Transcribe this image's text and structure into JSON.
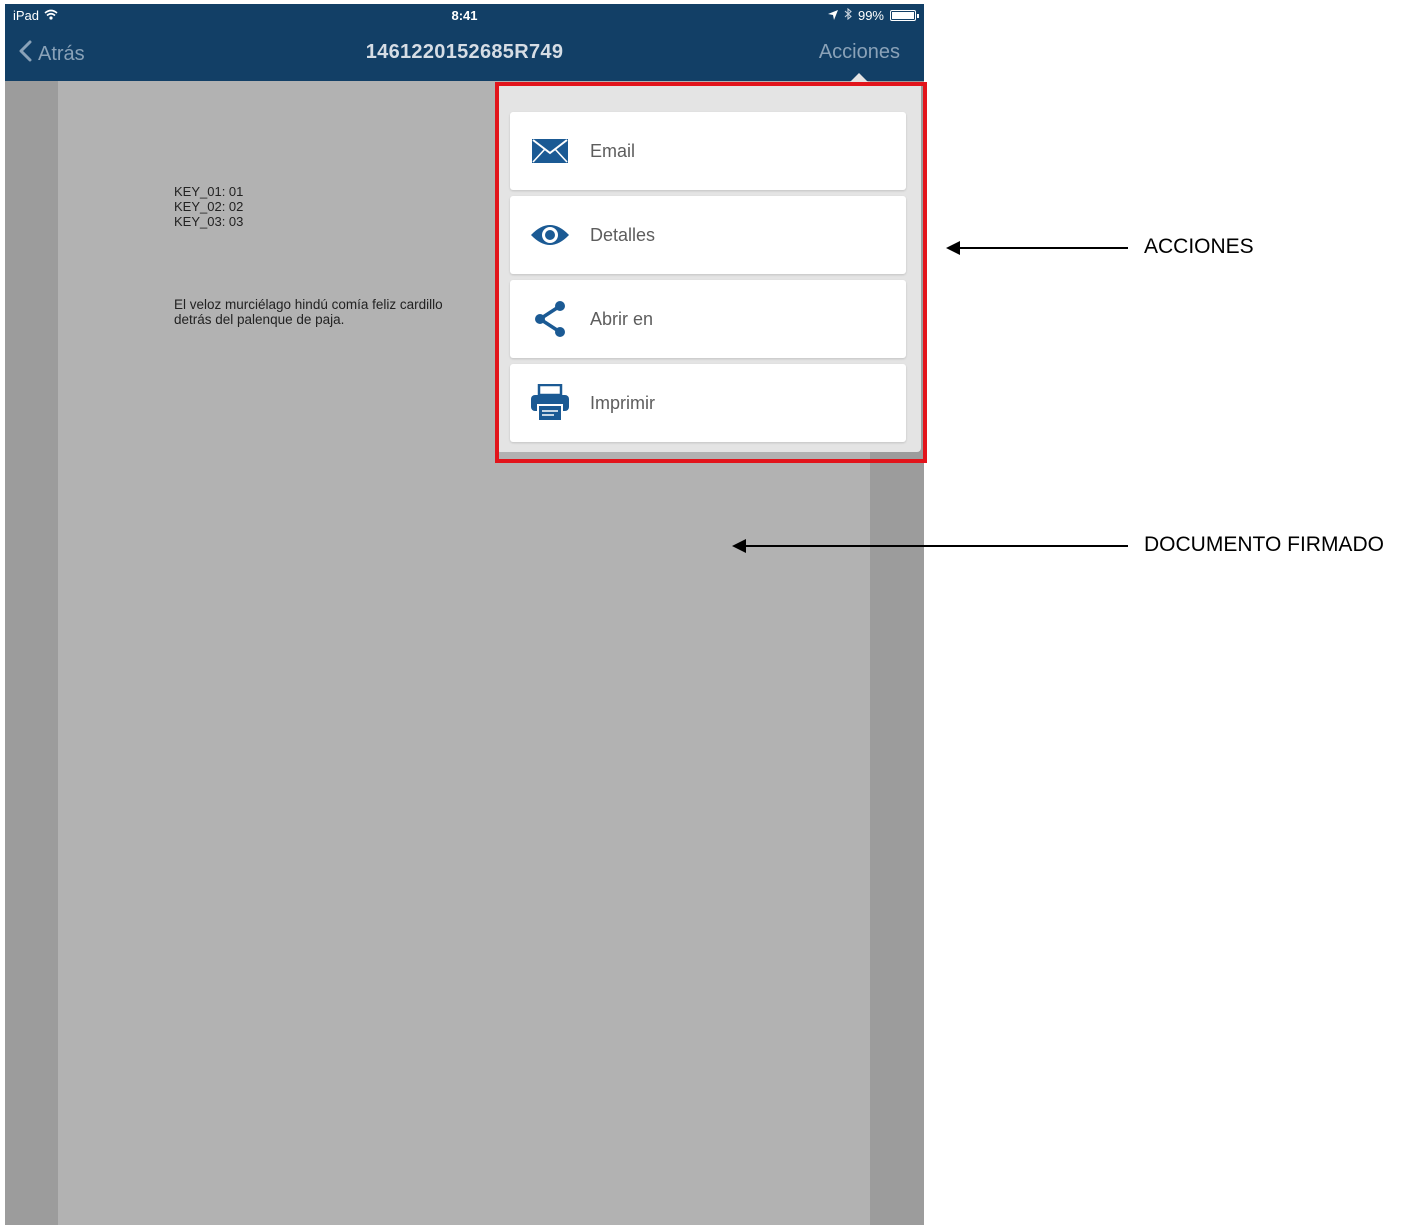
{
  "status_bar": {
    "device": "iPad",
    "time": "8:41",
    "battery": "99%",
    "battery_level": 0.99
  },
  "navbar": {
    "back_label": "Atrás",
    "title": "1461220152685R749",
    "actions_label": "Acciones"
  },
  "document": {
    "keys": [
      "KEY_01: 01",
      "KEY_02: 02",
      "KEY_03: 03"
    ],
    "body_line1": "El veloz murciélago hindú comía feliz cardillo",
    "body_line2": "detrás del palenque de paja."
  },
  "menu": {
    "items": [
      {
        "label": "Email",
        "icon": "envelope-icon"
      },
      {
        "label": "Detalles",
        "icon": "eye-icon"
      },
      {
        "label": "Abrir en",
        "icon": "share-icon"
      },
      {
        "label": "Imprimir",
        "icon": "printer-icon"
      }
    ]
  },
  "annotations": {
    "actions": "ACCIONES",
    "signed_document": "DOCUMENTO FIRMADO"
  },
  "colors": {
    "navbar": "#123f66",
    "icon_blue": "#1b5a94",
    "highlight": "#e2141b"
  }
}
